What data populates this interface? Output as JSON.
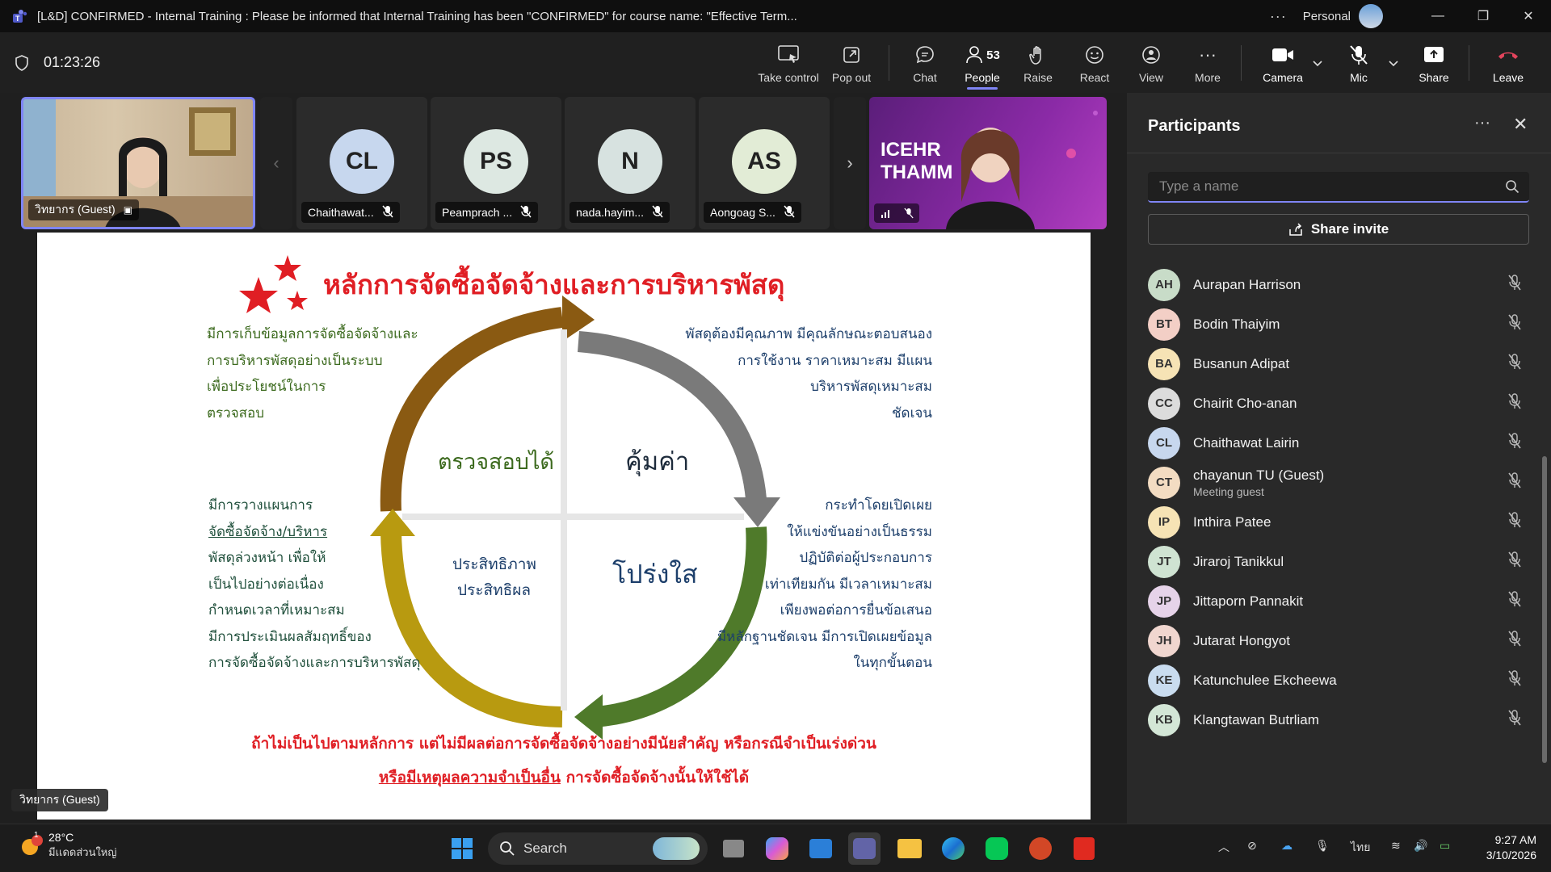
{
  "window": {
    "title": "[L&D] CONFIRMED - Internal Training : Please be informed that Internal Training has been \"CONFIRMED\" for course name: \"Effective Term...",
    "more": "···",
    "profile": "Personal"
  },
  "meeting": {
    "elapsed": "01:23:26",
    "toolbar": {
      "take_control": "Take control",
      "pop_out": "Pop out",
      "chat": "Chat",
      "people": "People",
      "people_count": "53",
      "raise": "Raise",
      "react": "React",
      "view": "View",
      "more": "More",
      "camera": "Camera",
      "mic": "Mic",
      "share": "Share",
      "leave": "Leave"
    }
  },
  "video_strip": {
    "self": {
      "name": "วิทยากร (Guest)"
    },
    "tiles": [
      {
        "initials": "CL",
        "name": "Chaithawat...",
        "color": "#c7d7ee"
      },
      {
        "initials": "PS",
        "name": "Peamprach ...",
        "color": "#dde8e2"
      },
      {
        "initials": "N",
        "name": "nada.hayim...",
        "color": "#d7e2e0"
      },
      {
        "initials": "AS",
        "name": "Aongoag S...",
        "color": "#e2ecd6"
      }
    ],
    "presenter_banner": "ICEHR THAMM"
  },
  "slide": {
    "title": "หลักการจัดซื้อจัดจ้างและการบริหารพัสดุ",
    "quadrants": {
      "top_left": "ตรวจสอบได้",
      "top_right": "คุ้มค่า",
      "bottom_left_1": "ประสิทธิภาพ",
      "bottom_left_2": "ประสิทธิผล",
      "bottom_right": "โปร่งใส"
    },
    "notes_top_left": [
      "มีการเก็บข้อมูลการจัดซื้อจัดจ้างและ",
      "การบริหารพัสดุอย่างเป็นระบบ",
      "เพื่อประโยชน์ในการ",
      "ตรวจสอบ"
    ],
    "notes_top_right": [
      "พัสดุต้องมีคุณภาพ มีคุณลักษณะตอบสนอง",
      "การใช้งาน ราคาเหมาะสม มีแผน",
      "บริหารพัสดุเหมาะสม",
      "ชัดเจน"
    ],
    "notes_bottom_left": [
      "มีการวางแผนการ",
      "จัดซื้อจัดจ้าง/บริหาร",
      "พัสดุล่วงหน้า เพื่อให้",
      "เป็นไปอย่างต่อเนื่อง",
      "กำหนดเวลาที่เหมาะสม",
      "มีการประเมินผลสัมฤทธิ์ของ",
      "การจัดซื้อจัดจ้างและการบริหารพัสดุ"
    ],
    "notes_bottom_right": [
      "กระทำโดยเปิดเผย",
      "ให้แข่งขันอย่างเป็นธรรม",
      "ปฏิบัติต่อผู้ประกอบการ",
      "เท่าเทียมกัน มีเวลาเหมาะสม",
      "เพียงพอต่อการยื่นข้อเสนอ",
      "มีหลักฐานชัดเจน มีการเปิดเผยข้อมูล",
      "ในทุกขั้นตอน"
    ],
    "footer_1": "ถ้าไม่เป็นไปตามหลักการ แต่ไม่มีผลต่อการจัดซื้อจัดจ้างอย่างมีนัยสำคัญ  หรือกรณีจำเป็นเร่งด่วน",
    "footer_2a": "หรือมีเหตุผลความจำเป็นอื่น",
    "footer_2b": " การจัดซื้อจัดจ้างนั้นให้ใช้ได้"
  },
  "presenter_tag": "วิทยากร (Guest)",
  "participants": {
    "title": "Participants",
    "search_placeholder": "Type a name",
    "share_invite": "Share invite",
    "list": [
      {
        "initials": "AH",
        "name": "Aurapan Harrison",
        "sub": "",
        "color": "#c8dcc8"
      },
      {
        "initials": "BT",
        "name": "Bodin Thaiyim",
        "sub": "",
        "color": "#f3cfc6"
      },
      {
        "initials": "BA",
        "name": "Busanun Adipat",
        "sub": "",
        "color": "#f6e3b5"
      },
      {
        "initials": "CC",
        "name": "Chairit Cho-anan",
        "sub": "",
        "color": "#dcdcdc"
      },
      {
        "initials": "CL",
        "name": "Chaithawat Lairin",
        "sub": "",
        "color": "#c7d7ee"
      },
      {
        "initials": "CT",
        "name": "chayanun TU (Guest)",
        "sub": "Meeting guest",
        "color": "#f3dcc2"
      },
      {
        "initials": "IP",
        "name": "Inthira Patee",
        "sub": "",
        "color": "#f6e3b5"
      },
      {
        "initials": "JT",
        "name": "Jiraroj Tanikkul",
        "sub": "",
        "color": "#cfe3d2"
      },
      {
        "initials": "JP",
        "name": "Jittaporn Pannakit",
        "sub": "",
        "color": "#e6d3e9"
      },
      {
        "initials": "JH",
        "name": "Jutarat Hongyot",
        "sub": "",
        "color": "#f0d6cf"
      },
      {
        "initials": "KE",
        "name": "Katunchulee Ekcheewa",
        "sub": "",
        "color": "#c9dcef"
      },
      {
        "initials": "KB",
        "name": "Klangtawan Butrliam",
        "sub": "",
        "color": "#d3e6d6"
      }
    ]
  },
  "taskbar": {
    "weather_temp": "28°C",
    "weather_cond": "มีเเดดส่วนใหญ่",
    "weather_badge": "1",
    "search": "Search",
    "language": "ไทย",
    "time": "9:27 AM",
    "date": "3/10/2026"
  }
}
